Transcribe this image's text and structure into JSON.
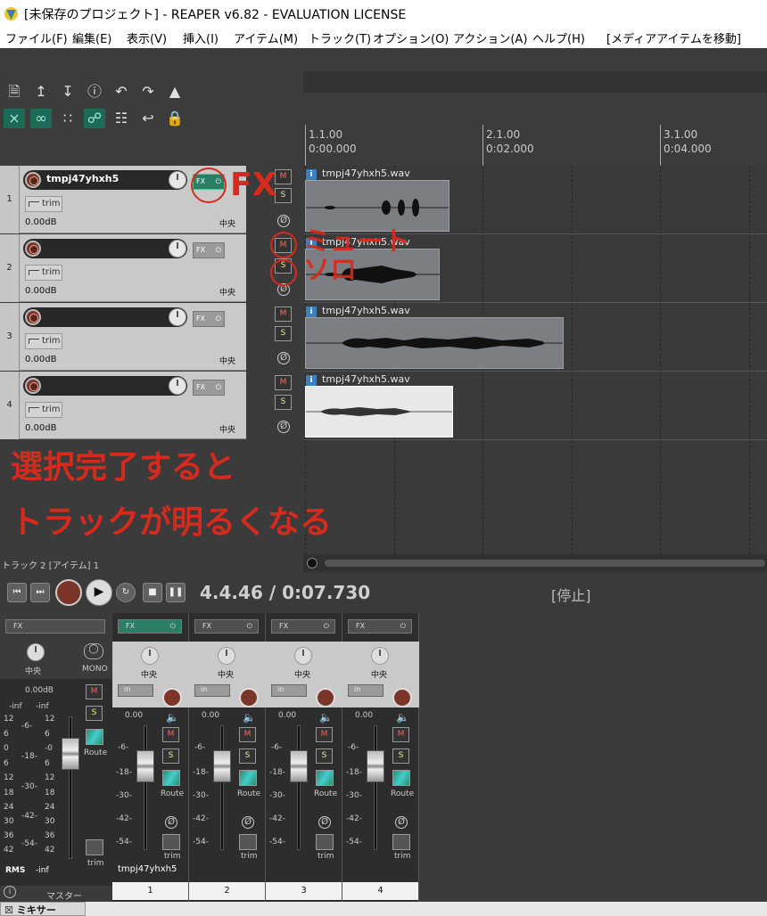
{
  "window": {
    "title": "[未保存のプロジェクト] - REAPER v6.82 - EVALUATION LICENSE"
  },
  "menu": [
    "ファイル(F)",
    "編集(E)",
    "表示(V)",
    "挿入(I)",
    "アイテム(M)",
    "トラック(T)",
    "オプション(O)",
    "アクション(A)",
    "ヘルプ(H)",
    "[メディアアイテムを移動]"
  ],
  "ruler": {
    "markers": [
      {
        "bar": "1.1.00",
        "time": "0:00.000"
      },
      {
        "bar": "2.1.00",
        "time": "0:02.000"
      },
      {
        "bar": "3.1.00",
        "time": "0:04.000"
      }
    ]
  },
  "tracks": [
    {
      "num": "1",
      "name": "tmpj47yhxh5",
      "volume": "0.00dB",
      "pan": "中央",
      "fx_active": true,
      "trim": "trim"
    },
    {
      "num": "2",
      "name": "",
      "volume": "0.00dB",
      "pan": "中央",
      "fx_active": false,
      "trim": "trim"
    },
    {
      "num": "3",
      "name": "",
      "volume": "0.00dB",
      "pan": "中央",
      "fx_active": false,
      "trim": "trim"
    },
    {
      "num": "4",
      "name": "",
      "volume": "0.00dB",
      "pan": "中央",
      "fx_active": false,
      "trim": "trim"
    }
  ],
  "buttons": {
    "mute": "M",
    "solo": "S",
    "fx": "FX"
  },
  "items": [
    {
      "name": "tmpj47yhxh5.wav"
    },
    {
      "name": "tmpj47yhxh5.wav"
    },
    {
      "name": "tmpj47yhxh5.wav"
    },
    {
      "name": "tmpj47yhxh5.wav"
    }
  ],
  "annotations": {
    "fx": "FX",
    "mute": "ミュート",
    "solo": "ソロ",
    "note_line1": "選択完了すると",
    "note_line2": "トラックが明るくなる"
  },
  "status": {
    "selection": "トラック 2 [アイテム] 1"
  },
  "transport": {
    "position": "4.4.46 / 0:07.730",
    "state": "[停止]"
  },
  "mixer": {
    "master": {
      "label": "マスター",
      "pan": "中央",
      "mono": "MONO",
      "volume": "0.00dB",
      "rms": "RMS",
      "left_peak": "-inf",
      "right_peak": "-inf",
      "rms_value": "-inf",
      "scale_left": [
        "12",
        "6",
        "0",
        "6",
        "12",
        "18",
        "24",
        "30",
        "36",
        "42"
      ],
      "scale_mid": [
        "-6-",
        "-18-",
        "-30-",
        "-42-",
        "-54-"
      ],
      "scale_right": [
        "12",
        "6",
        "-0",
        "6",
        "12",
        "18",
        "24",
        "30",
        "36",
        "42"
      ]
    },
    "strips": [
      {
        "num": "1",
        "name": "tmpj47yhxh5",
        "pan": "中央",
        "volume": "0.00",
        "input": "in",
        "fx_active": true
      },
      {
        "num": "2",
        "name": "",
        "pan": "中央",
        "volume": "0.00",
        "input": "in",
        "fx_active": false
      },
      {
        "num": "3",
        "name": "",
        "pan": "中央",
        "volume": "0.00",
        "input": "in",
        "fx_active": false
      },
      {
        "num": "4",
        "name": "",
        "pan": "中央",
        "volume": "0.00",
        "input": "in",
        "fx_active": false
      }
    ],
    "scale": [
      "-6-",
      "-18-",
      "-30-",
      "-42-",
      "-54-"
    ],
    "route_label": "Route",
    "trim_label": "trim",
    "tab": "ミキサー"
  },
  "colors": {
    "record": "#7c3629",
    "fx_on": "#2a7e63",
    "annotation": "#d62a1c",
    "track_bg": "#c9c9c9"
  }
}
